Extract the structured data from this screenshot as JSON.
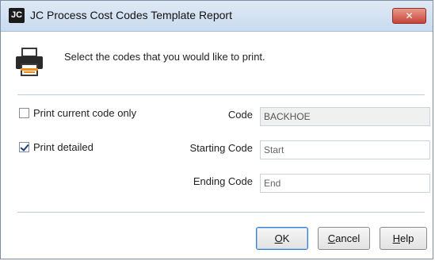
{
  "window": {
    "app_badge": "JC",
    "title": "JC Process Cost Codes Template Report",
    "close_glyph": "✕"
  },
  "header": {
    "icon": "printer-icon",
    "instruction": "Select the codes that you would like to print."
  },
  "options": {
    "print_current_code_only": {
      "label": "Print current code only",
      "checked": false
    },
    "print_detailed": {
      "label": "Print detailed",
      "checked": true
    }
  },
  "fields": {
    "code": {
      "label": "Code",
      "value": "BACKHOE",
      "readonly": true
    },
    "starting_code": {
      "label": "Starting Code",
      "placeholder": "Start",
      "value": ""
    },
    "ending_code": {
      "label": "Ending Code",
      "placeholder": "End",
      "value": ""
    }
  },
  "buttons": {
    "ok": {
      "mnemonic": "O",
      "rest": "K"
    },
    "cancel": {
      "mnemonic": "C",
      "rest": "ancel"
    },
    "help": {
      "mnemonic": "H",
      "rest": "elp"
    }
  },
  "colors": {
    "titlebar": "#c9dbef",
    "close_button": "#c8443a",
    "separator": "#b9cde3",
    "default_button_border": "#3b7fd1"
  }
}
